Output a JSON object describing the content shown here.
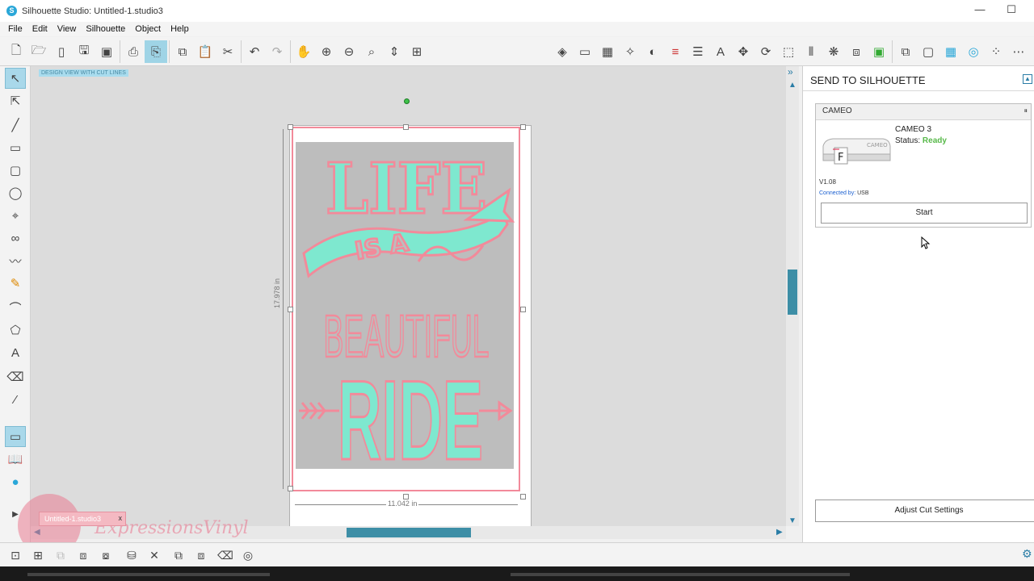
{
  "window": {
    "title": "Silhouette Studio: Untitled-1.studio3"
  },
  "menu": [
    "File",
    "Edit",
    "View",
    "Silhouette",
    "Object",
    "Help"
  ],
  "canvas": {
    "view_label": "DESIGN VIEW WITH CUT LINES",
    "height_label": "17.978 in",
    "width_label": "11.042 in"
  },
  "artwork": {
    "lines": [
      "LIFE",
      "IS A",
      "BEAUTIFUL",
      "RIDE"
    ]
  },
  "doc_tab": {
    "label": "Untitled-1.studio3",
    "close": "x"
  },
  "watermark": {
    "text": "ExpressionsVinyl"
  },
  "panel": {
    "title": "SEND TO SILHOUETTE",
    "device_group": "CAMEO",
    "device_name": "CAMEO 3",
    "status_label": "Status:",
    "status_value": "Ready",
    "version": "V1.08",
    "connected_label": "Connected by:",
    "connected_value": "USB",
    "start_label": "Start",
    "adjust_label": "Adjust Cut Settings",
    "machine_label": "CAMEO",
    "machine_badge": "F"
  },
  "colors": {
    "accent": "#2aa7d8",
    "cut_line": "#f28a9a",
    "fill": "#7ee8cf",
    "status_ready": "#58b94a"
  }
}
